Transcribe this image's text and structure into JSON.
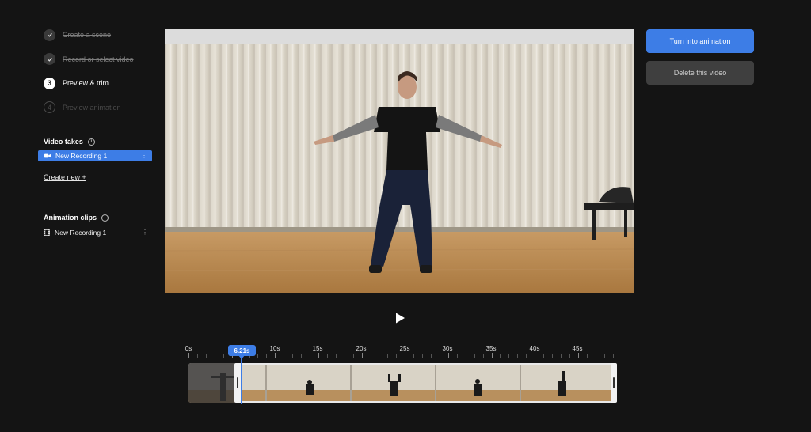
{
  "steps": [
    {
      "label": "Create a scene",
      "state": "done"
    },
    {
      "label": "Record or select video",
      "state": "done"
    },
    {
      "number": "3",
      "label": "Preview & trim",
      "state": "active"
    },
    {
      "number": "4",
      "label": "Preview animation",
      "state": "pending"
    }
  ],
  "video_takes": {
    "title": "Video takes",
    "items": [
      {
        "label": "New Recording 1",
        "selected": true
      }
    ],
    "create_new": "Create new +"
  },
  "animation_clips": {
    "title": "Animation clips",
    "items": [
      {
        "label": "New Recording 1"
      }
    ]
  },
  "actions": {
    "primary": "Turn into animation",
    "secondary": "Delete this video"
  },
  "timeline": {
    "ticks": [
      "0s",
      "5s",
      "10s",
      "15s",
      "20s",
      "25s",
      "30s",
      "35s",
      "40s",
      "45s"
    ],
    "playhead_label": "6.21s"
  },
  "colors": {
    "accent": "#3d7de6",
    "background": "#141414"
  }
}
